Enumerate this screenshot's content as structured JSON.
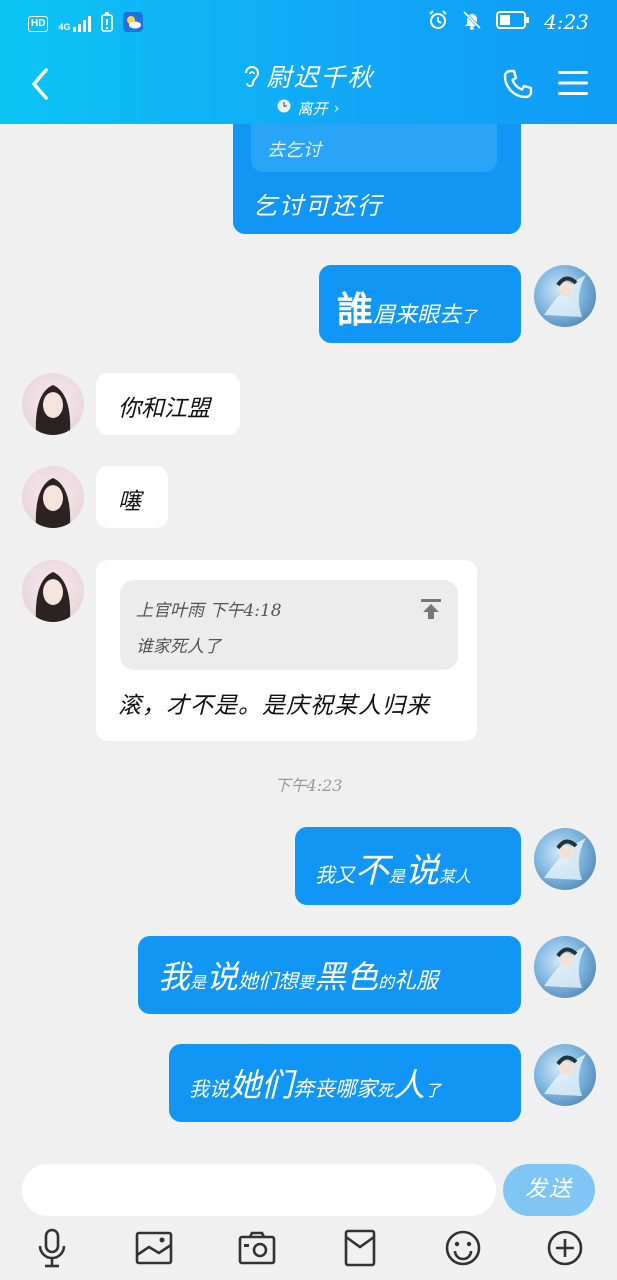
{
  "status_bar": {
    "left_icons": [
      "hd-icon",
      "signal-4g-icon",
      "battery-saver-icon",
      "weather-app-icon"
    ],
    "hd_label": "HD",
    "network_label": "4G",
    "time": "4:23"
  },
  "header": {
    "title": "尉迟千秋",
    "status": "离开",
    "status_arrow": "›"
  },
  "messages": {
    "m1_quote": "去乞讨",
    "m1_text": "乞讨可还行",
    "m2_big": "誰",
    "m2_rest": "眉来眼去",
    "m2_small": "了",
    "m3_text": "你和江盟",
    "m4_text": "噻",
    "m5_quote_name": "上官叶雨 下午4:18",
    "m5_quote_text": "谁家死人了",
    "m5_text": "滚，才不是。是庆祝某人归来",
    "timestamp": "下午4:23",
    "m6_parts": [
      "我",
      "又",
      "不",
      "是",
      "说",
      "某人"
    ],
    "m7_parts": [
      "我",
      "是",
      "说",
      "她们想",
      "要",
      "黑",
      "色",
      "的",
      "礼服"
    ],
    "m8_parts": [
      "我说",
      "她们",
      "奔丧哪家",
      "死",
      "人",
      "了"
    ]
  },
  "input": {
    "placeholder": "",
    "send_label": "发送"
  },
  "toolbar": {
    "icons": [
      "microphone-icon",
      "image-icon",
      "camera-icon",
      "red-packet-icon",
      "emoji-icon",
      "plus-icon"
    ]
  },
  "colors": {
    "header_start": "#0cc4f4",
    "header_end": "#0f9cf6",
    "bubble_blue": "#1296f5",
    "send_button": "#7fc6f5"
  }
}
